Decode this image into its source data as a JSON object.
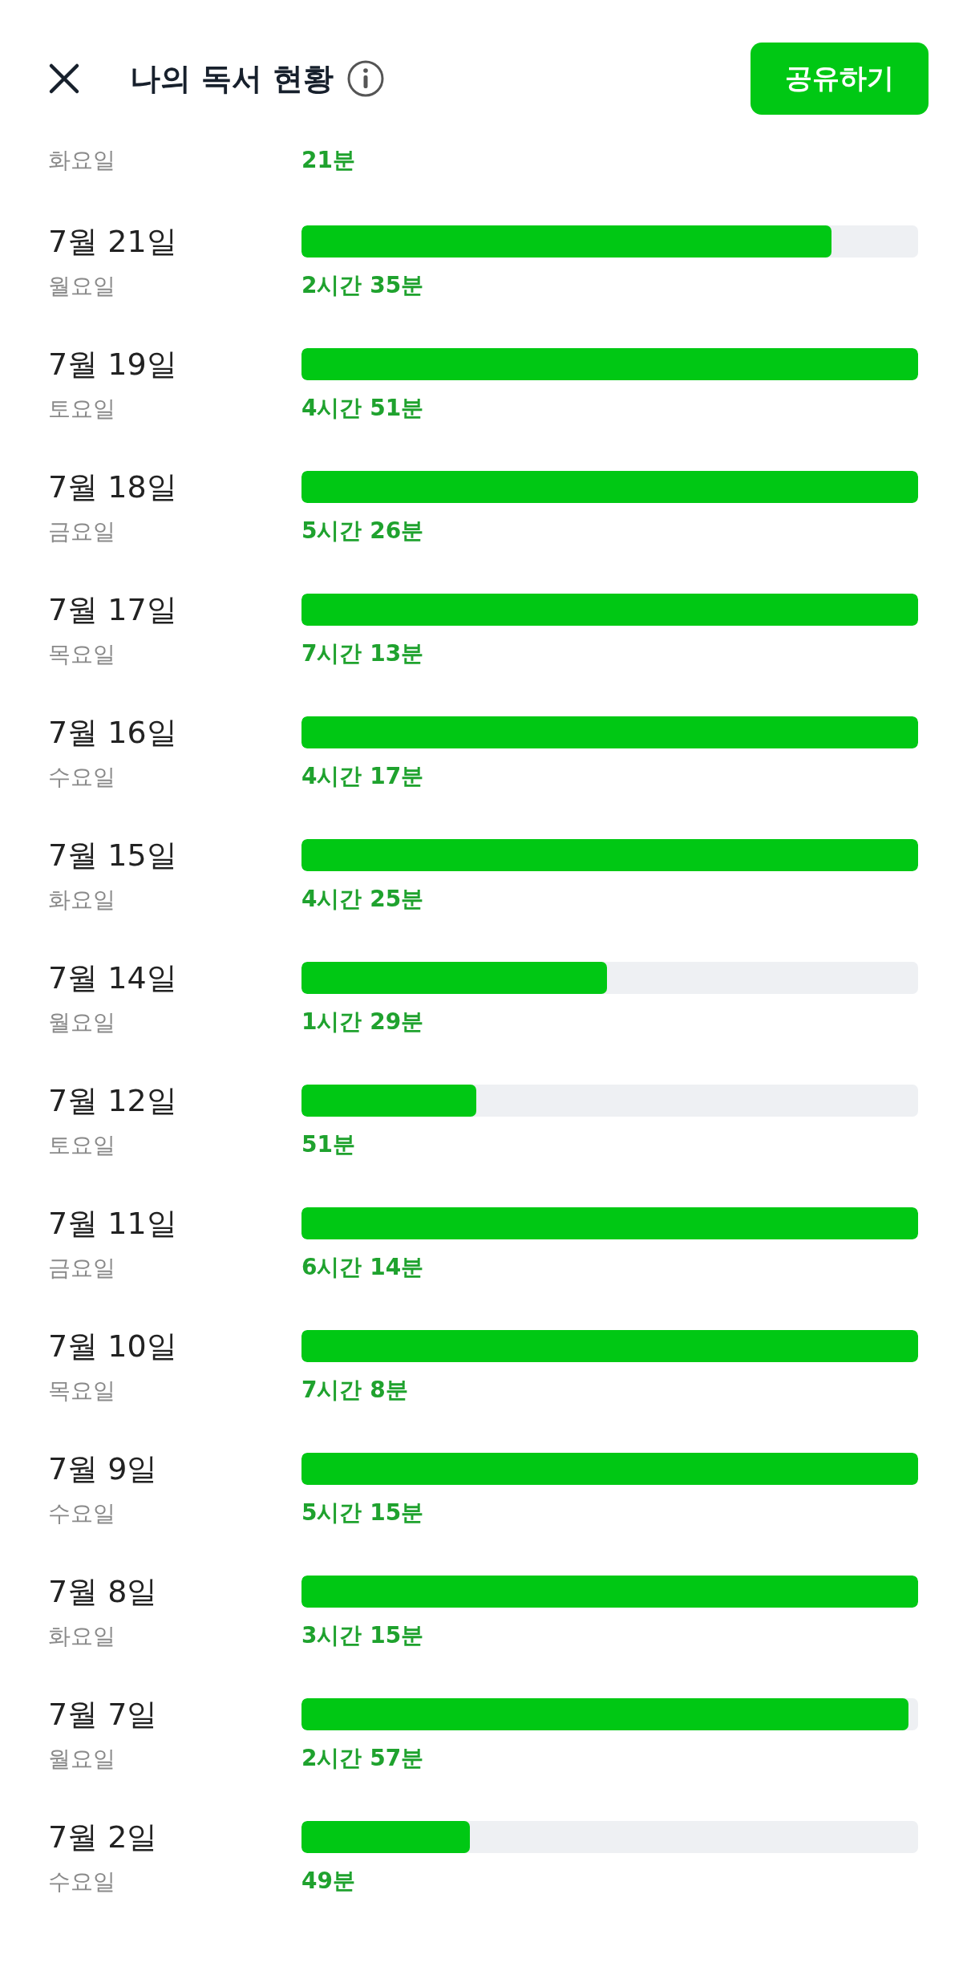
{
  "header": {
    "title": "나의 독서 현황",
    "share_button": "공유하기"
  },
  "days": [
    {
      "weekday": "화요일",
      "duration": "21분"
    },
    {
      "date": "7월 21일",
      "weekday": "월요일",
      "level": 0.86,
      "duration": "2시간 35분"
    },
    {
      "date": "7월 19일",
      "weekday": "토요일",
      "level": 1,
      "duration": "4시간 51분"
    },
    {
      "date": "7월 18일",
      "weekday": "금요일",
      "level": 1,
      "duration": "5시간 26분"
    },
    {
      "date": "7월 17일",
      "weekday": "목요일",
      "level": 1,
      "duration": "7시간 13분"
    },
    {
      "date": "7월 16일",
      "weekday": "수요일",
      "level": 1,
      "duration": "4시간 17분"
    },
    {
      "date": "7월 15일",
      "weekday": "화요일",
      "level": 1,
      "duration": "4시간 25분"
    },
    {
      "date": "7월 14일",
      "weekday": "월요일",
      "level": 0.495,
      "duration": "1시간 29분"
    },
    {
      "date": "7월 12일",
      "weekday": "토요일",
      "level": 0.283,
      "duration": "51분"
    },
    {
      "date": "7월 11일",
      "weekday": "금요일",
      "level": 1,
      "duration": "6시간 14분"
    },
    {
      "date": "7월 10일",
      "weekday": "목요일",
      "level": 1,
      "duration": "7시간 8분"
    },
    {
      "date": "7월 9일",
      "weekday": "수요일",
      "level": 1,
      "duration": "5시간 15분"
    },
    {
      "date": "7월 8일",
      "weekday": "화요일",
      "level": 1,
      "duration": "3시간 15분"
    },
    {
      "date": "7월 7일",
      "weekday": "월요일",
      "level": 0.984,
      "duration": "2시간 57분"
    },
    {
      "date": "7월 2일",
      "weekday": "수요일",
      "level": 0.273,
      "duration": "49분"
    }
  ]
}
